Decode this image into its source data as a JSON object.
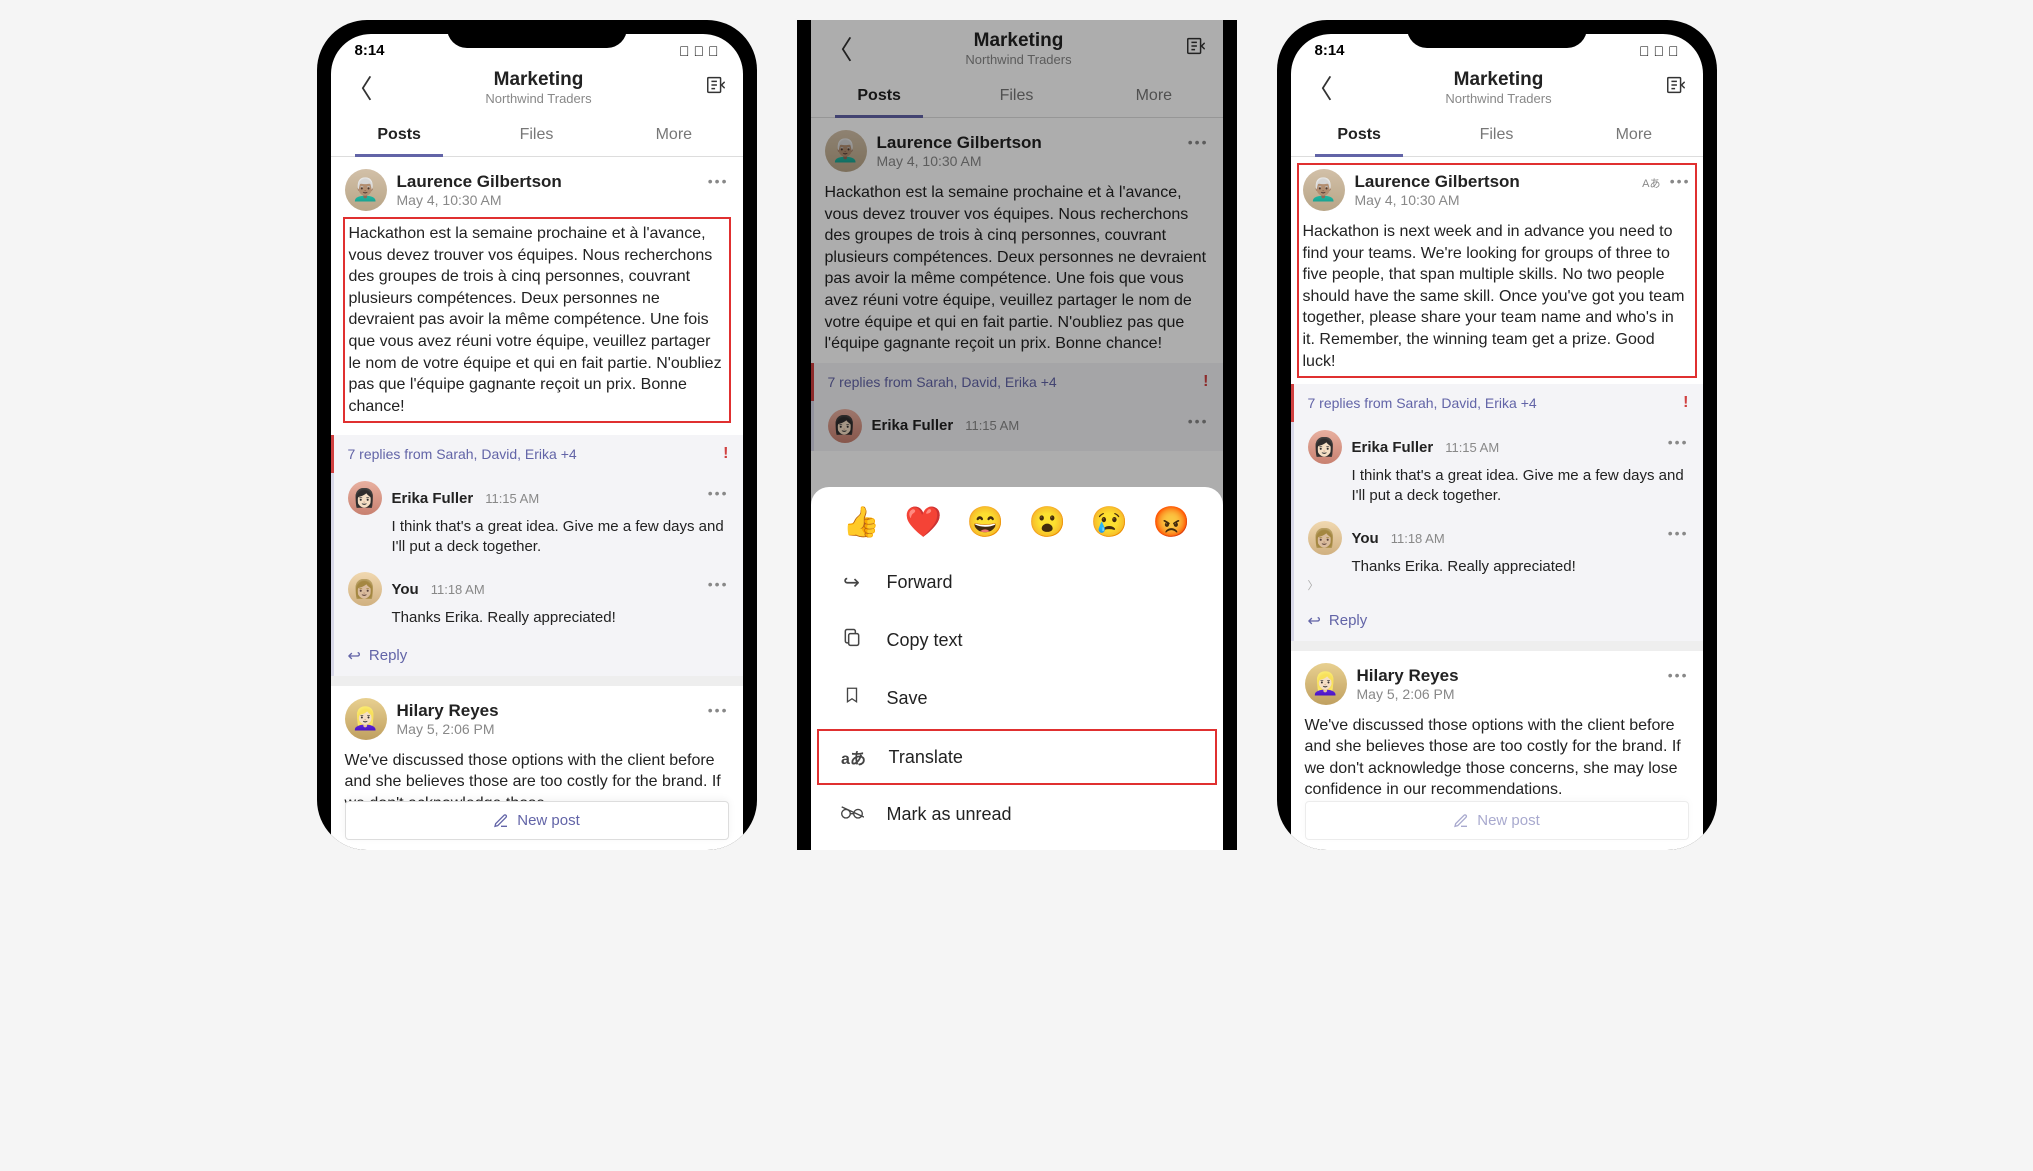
{
  "status": {
    "time": "8:14",
    "icons": "􀙇"
  },
  "header": {
    "channel": "Marketing",
    "team": "Northwind Traders"
  },
  "tabs": [
    "Posts",
    "Files",
    "More"
  ],
  "post1": {
    "author": "Laurence Gilbertson",
    "timestamp": "May 4, 10:30 AM",
    "body_fr": "Hackathon est la semaine prochaine et à l'avance, vous devez trouver vos équipes. Nous recherchons des groupes de trois à cinq personnes, couvrant plusieurs compétences. Deux personnes ne devraient pas avoir la même compétence. Une fois que vous avez réuni votre équipe, veuillez partager le nom de votre équipe et qui en fait partie. N'oubliez pas que l'équipe gagnante reçoit un prix. Bonne chance!",
    "body_en": "Hackathon is next week and in advance you need to find your teams. We're looking for groups of three to five people, that span multiple skills. No two people should have the same skill. Once you've got you team together, please share your team name and who's in it. Remember, the winning team get a prize. Good luck!",
    "replies_summary": "7 replies from Sarah, David, Erika +4"
  },
  "reply1": {
    "author": "Erika Fuller",
    "timestamp": "11:15 AM",
    "body": "I think that's a great idea. Give me a few days and I'll put a deck together."
  },
  "reply2": {
    "author": "You",
    "timestamp": "11:18 AM",
    "body": "Thanks Erika. Really appreciated!"
  },
  "reply_label": "Reply",
  "post2": {
    "author": "Hilary Reyes",
    "timestamp": "May 5, 2:06 PM",
    "body_short": "We've discussed those options with the client before and she believes those are too costly for the brand. If we don't acknowledge those",
    "body_long": "We've discussed those options with the client before and she believes those are too costly for the brand. If we don't acknowledge those concerns, she may lose confidence in our recommendations."
  },
  "new_post_label": "New post",
  "actions": {
    "reactions": [
      "👍",
      "❤️",
      "😄",
      "😮",
      "😢",
      "😡"
    ],
    "forward": "Forward",
    "copy": "Copy text",
    "save": "Save",
    "translate": "Translate",
    "unread": "Mark as unread"
  },
  "translate_badge": "Aあ"
}
